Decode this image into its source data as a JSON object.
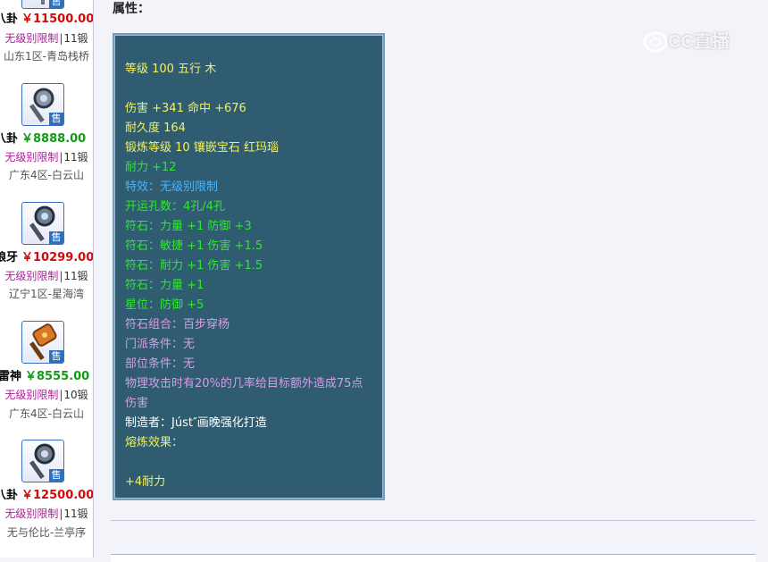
{
  "sidebar": {
    "listings": [
      {
        "name": "八卦",
        "price": "￥11500.00",
        "price_color": "red",
        "limit": "无级别限制",
        "forge": "11锻",
        "server": "山东1区-青岛栈桥",
        "icon": "staff-icon"
      },
      {
        "name": "八卦",
        "price": "￥8888.00",
        "price_color": "green",
        "limit": "无级别限制",
        "forge": "11锻",
        "server": "广东4区-白云山",
        "icon": "staff-icon"
      },
      {
        "name": "狼牙",
        "price": "￥10299.00",
        "price_color": "red",
        "limit": "无级别限制",
        "forge": "11锻",
        "server": "辽宁1区-星海湾",
        "icon": "mace-icon"
      },
      {
        "name": "雷神",
        "price": "￥8555.00",
        "price_color": "green",
        "limit": "无级别限制",
        "forge": "10锻",
        "server": "广东4区-白云山",
        "icon": "hammer-icon"
      },
      {
        "name": "八卦",
        "price": "￥12500.00",
        "price_color": "red",
        "limit": "无级别限制",
        "forge": "11锻",
        "server": "无与伦比-兰亭序",
        "icon": "staff-icon"
      }
    ],
    "sell_tag": "售",
    "separator": "|"
  },
  "main": {
    "attr_heading": "属性：",
    "props": [
      {
        "text": "等级 100 五行 木",
        "color": "yellow"
      },
      {
        "text": "伤害 +341 命中 +676",
        "color": "yellow"
      },
      {
        "text": "耐久度 164",
        "color": "yellow"
      },
      {
        "text": "锻炼等级 10 镶嵌宝石 红玛瑙",
        "color": "yellow"
      },
      {
        "text": "耐力 +12",
        "color": "green"
      },
      {
        "text": "特效：无级别限制",
        "color": "blue"
      },
      {
        "text": "开运孔数：4孔/4孔",
        "color": "green"
      },
      {
        "text": "符石：力量 +1 防御 +3",
        "color": "green"
      },
      {
        "text": "符石：敏捷 +1 伤害 +1.5",
        "color": "green"
      },
      {
        "text": "符石：耐力 +1 伤害 +1.5",
        "color": "green"
      },
      {
        "text": "符石：力量 +1",
        "color": "green"
      },
      {
        "text": "星位：防御 +5",
        "color": "green"
      },
      {
        "text": "符石组合：百步穿杨",
        "color": "purple"
      },
      {
        "text": "门派条件：无",
        "color": "purple"
      },
      {
        "text": "部位条件：无",
        "color": "purple"
      },
      {
        "text": "物理攻击时有20%的几率给目标额外造成75点",
        "color": "purple"
      },
      {
        "text": "伤害",
        "color": "purple"
      },
      {
        "text": "制造者：Júst″画晚强化打造",
        "color": "white"
      },
      {
        "text": "熔炼效果：",
        "color": "yellow"
      },
      {
        "text": "+4耐力",
        "color": "yellow"
      }
    ]
  },
  "watermark": {
    "text": "CC直播"
  },
  "colors": {
    "panel_bg": "#2f5c70",
    "yellow": "#f2f060",
    "green": "#2ee82e",
    "blue": "#4ab4ff",
    "purple": "#d79ee6",
    "price_red": "#d20a0a",
    "price_green": "#129a12",
    "limit_magenta": "#b5179e"
  }
}
